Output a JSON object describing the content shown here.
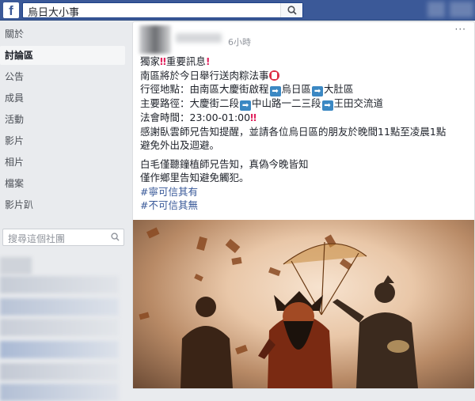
{
  "topbar": {
    "logo": "f",
    "search_value": "烏日大小事"
  },
  "sidebar": {
    "items": [
      {
        "label": "關於"
      },
      {
        "label": "討論區",
        "active": true
      },
      {
        "label": "公告"
      },
      {
        "label": "成員"
      },
      {
        "label": "活動"
      },
      {
        "label": "影片"
      },
      {
        "label": "相片"
      },
      {
        "label": "檔案"
      },
      {
        "label": "影片趴"
      }
    ],
    "search_placeholder": "搜尋這個社團"
  },
  "post": {
    "timestamp": "6小時",
    "more": "···",
    "lines": {
      "l1": "獨家",
      "l1b": "重要訊息",
      "l2": "南區將於今日舉行送肉粽法事",
      "l3a": "行徑地點：由南區大慶街啟程",
      "l3b": "烏日區",
      "l3c": "大肚區",
      "l4a": "主要路徑：大慶街二段",
      "l4b": "中山路一二三段",
      "l4c": "王田交流道",
      "l5": "法會時間：23:00-01:00",
      "l6": "感謝臥雲師兄告知提醒，並請各位烏日區的朋友於晚間11點至凌晨1點",
      "l7": "避免外出及迴避。",
      "l8": "白毛僅聽鐘植師兄告知，真偽今晚皆知",
      "l9": "僅作鄉里告知避免觸犯。",
      "tag1": "#寧可信其有",
      "tag2": "#不可信其無"
    }
  },
  "colors": {
    "brand": "#3b5998",
    "link": "#385898",
    "alert": "#e0245e"
  }
}
